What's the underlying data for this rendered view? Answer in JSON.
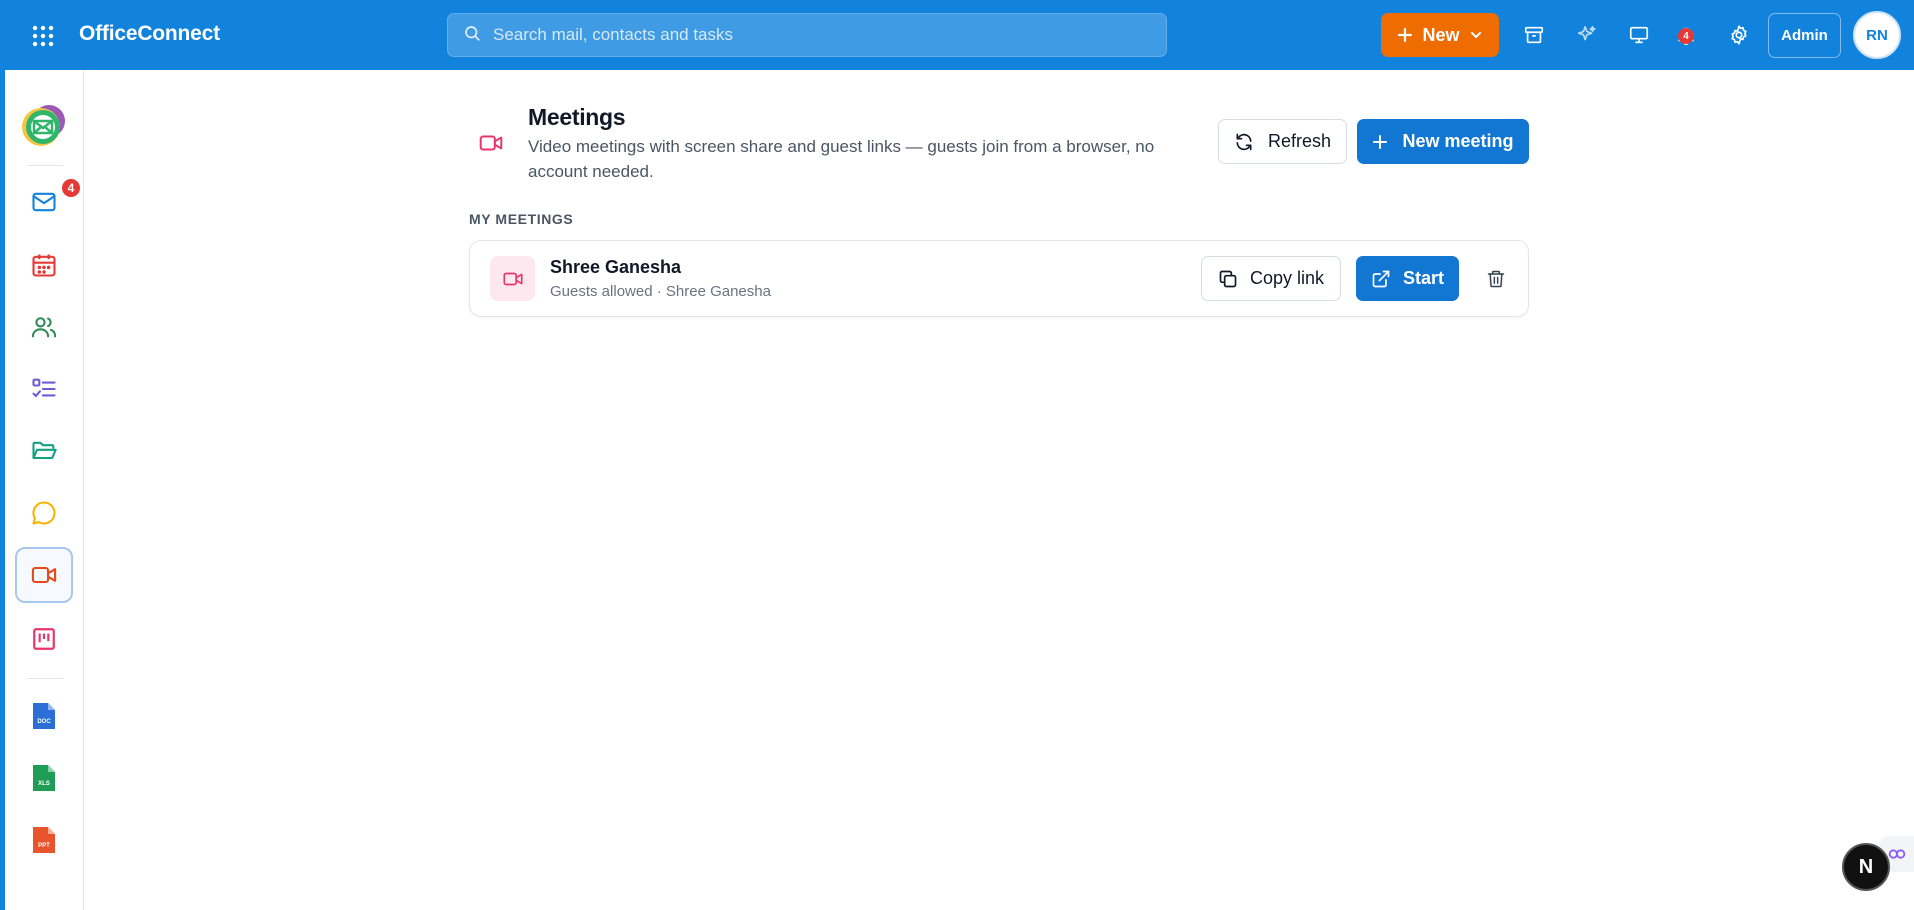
{
  "app": {
    "name": "OfficeConnect",
    "colors": {
      "brand": "#1283dd",
      "accent_orange": "#ef6c00",
      "primary_button": "#1276d3",
      "badge_red": "#e53935",
      "meeting_pink": "#e8356c"
    }
  },
  "topbar": {
    "apps_icon": "apps-grid-icon",
    "search": {
      "placeholder": "Search mail, contacts and tasks",
      "value": ""
    },
    "new_button": {
      "label": "New"
    },
    "icons": [
      "archive-icon",
      "sparkle-icon",
      "monitor-icon",
      "bell-icon",
      "gear-icon"
    ],
    "notification_count": "4",
    "admin_label": "Admin",
    "avatar_initials": "RN"
  },
  "sidebar": {
    "items": [
      {
        "name": "mail",
        "icon": "mail-icon",
        "badge": "4"
      },
      {
        "name": "calendar",
        "icon": "calendar-icon"
      },
      {
        "name": "contacts",
        "icon": "users-icon"
      },
      {
        "name": "tasks",
        "icon": "checklist-icon"
      },
      {
        "name": "files",
        "icon": "folder-icon"
      },
      {
        "name": "chat",
        "icon": "chat-icon"
      },
      {
        "name": "meetings",
        "icon": "video-icon",
        "active": true
      },
      {
        "name": "boards",
        "icon": "board-icon"
      },
      {
        "name": "doc",
        "icon": "doc-file-icon",
        "text": "DOC"
      },
      {
        "name": "xls",
        "icon": "xls-file-icon",
        "text": "XLS"
      },
      {
        "name": "ppt",
        "icon": "ppt-file-icon",
        "text": "PPT"
      }
    ]
  },
  "main": {
    "title": "Meetings",
    "subtitle": "Video meetings with screen share and guest links — guests join from a browser, no account needed.",
    "refresh_label": "Refresh",
    "new_meeting_label": "New meeting",
    "section_label": "MY MEETINGS",
    "meetings": [
      {
        "title": "Shree Ganesha",
        "subtitle": "Guests allowed · Shree Ganesha",
        "copy_label": "Copy link",
        "start_label": "Start"
      }
    ]
  },
  "floating": {
    "next_button": "N"
  }
}
